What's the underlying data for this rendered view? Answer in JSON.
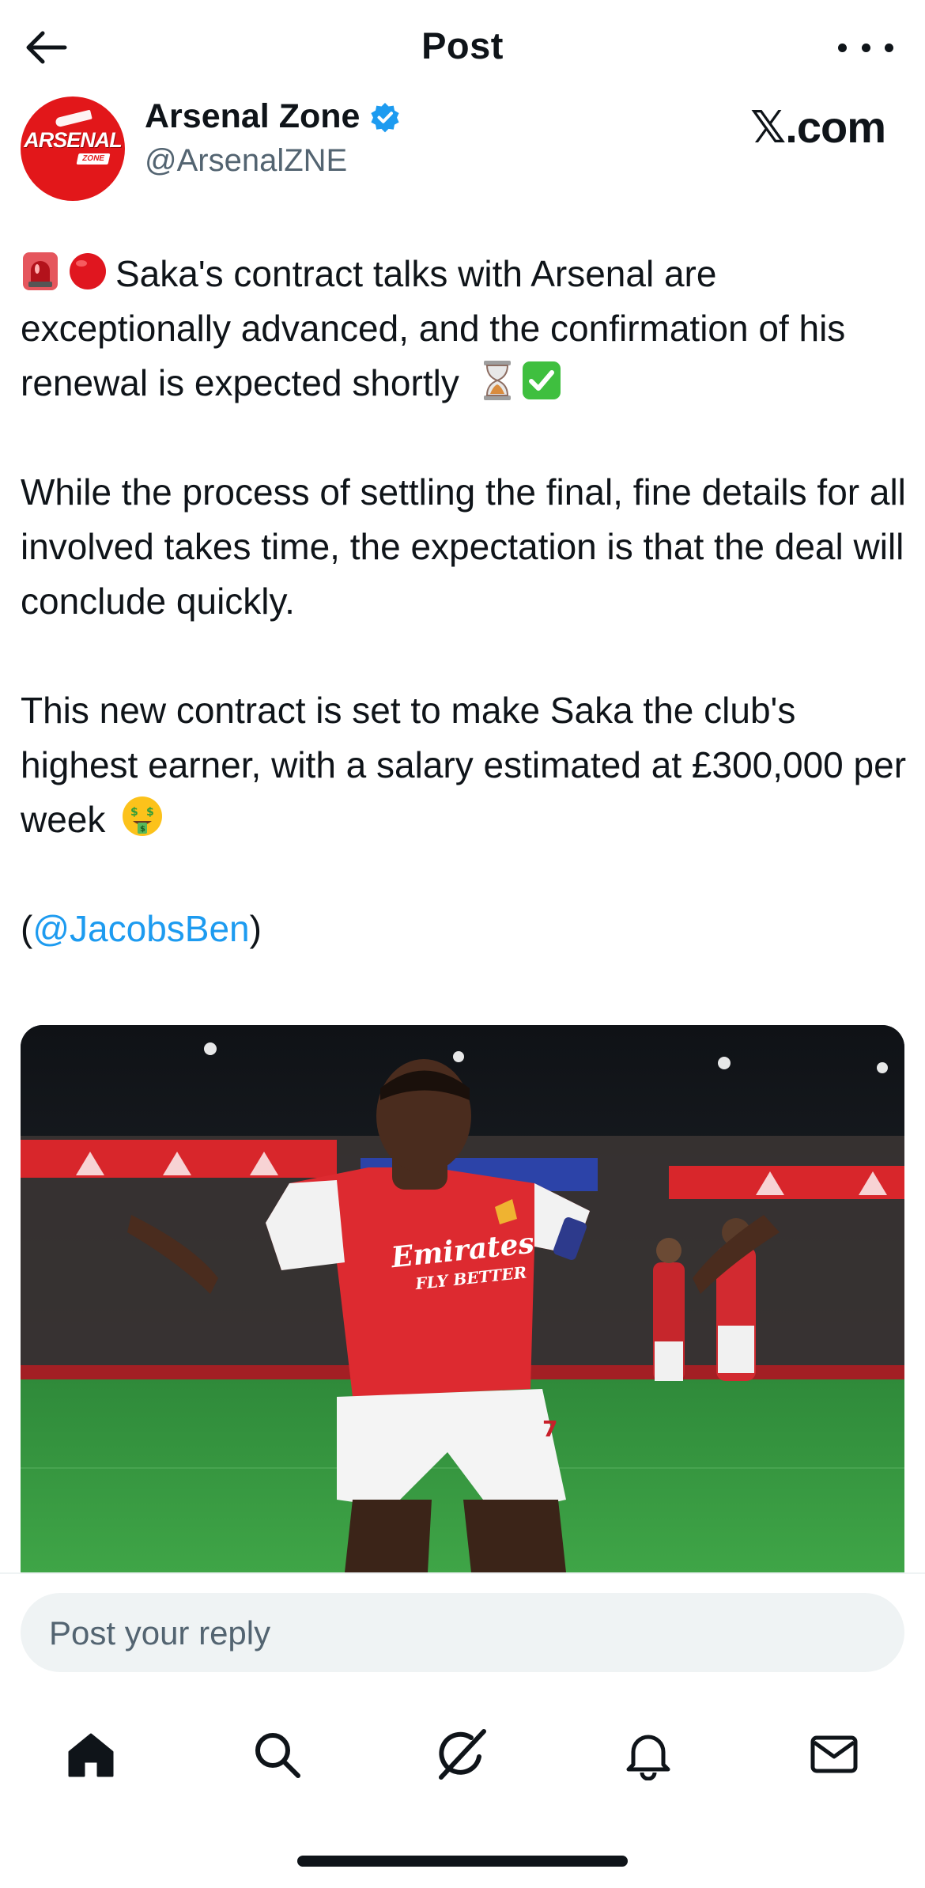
{
  "header": {
    "title": "Post",
    "back_icon": "arrow-left-icon",
    "more_icon": "more-horizontal-icon"
  },
  "author": {
    "display_name": "Arsenal Zone",
    "handle": "@ArsenalZNE",
    "verified": true,
    "avatar_text": "ARSENAL",
    "avatar_sub": "ZONE",
    "avatar_color": "#e2171a"
  },
  "watermark": "𝕏.com",
  "tweet": {
    "para1": "Saka's contract talks with Arsenal are exceptionally advanced, and the confirmation of his renewal is expected shortly",
    "para2": "While the process of settling the final, fine details for all involved takes time, the expectation is that the deal will conclude quickly.",
    "para3": "This new contract is set to make Saka the club's highest earner, with a salary estimated at £300,000 per week",
    "source_open": "(",
    "source_link": "@JacobsBen",
    "source_close": ")",
    "link_color": "#1d9bf0"
  },
  "media": {
    "sponsor_line1": "Emirates",
    "sponsor_line2": "FLY BETTER",
    "shirt_number": "7"
  },
  "reply": {
    "placeholder": "Post your reply"
  },
  "tabs": [
    {
      "name": "home",
      "icon": "home-icon",
      "active": true
    },
    {
      "name": "search",
      "icon": "search-icon",
      "active": false
    },
    {
      "name": "grok",
      "icon": "grok-icon",
      "active": false
    },
    {
      "name": "notifications",
      "icon": "bell-icon",
      "active": false
    },
    {
      "name": "messages",
      "icon": "mail-icon",
      "active": false
    }
  ]
}
